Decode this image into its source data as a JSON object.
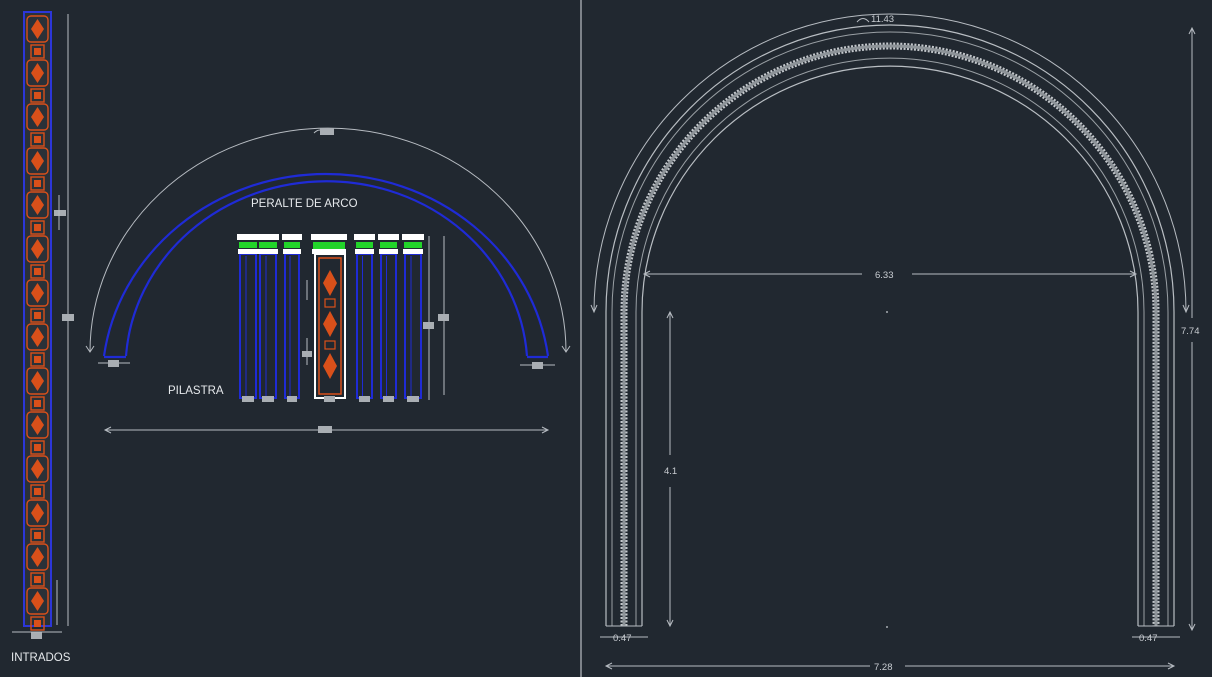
{
  "labels": {
    "intrados": "INTRADOS",
    "peralte": "PERALTE DE ARCO",
    "pilastra": "PILASTRA"
  },
  "dimensions": {
    "arc_length": "11.43",
    "inner_span": "6.33",
    "height": "7.74",
    "pier_height": "4.1",
    "left_pier_width": "0.47",
    "right_pier_width": "0.47",
    "total_width": "7.28"
  },
  "colors": {
    "background": "#212830",
    "blue": "#1f2bd6",
    "orange": "#d9501a",
    "green": "#22d42a",
    "white": "#ffffff",
    "dim_line": "#b7bcc2"
  }
}
